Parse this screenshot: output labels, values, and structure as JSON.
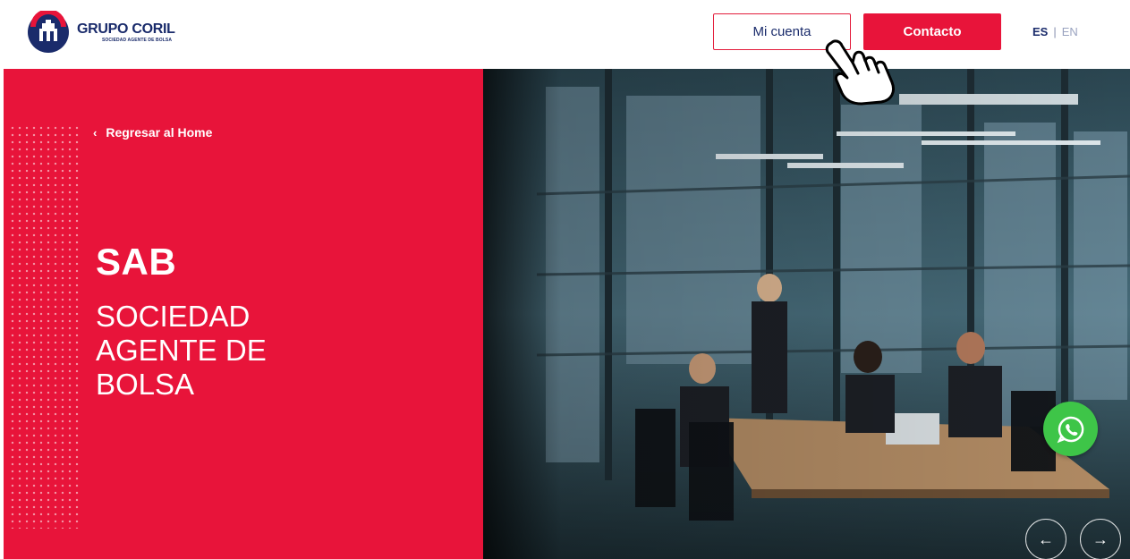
{
  "header": {
    "logo": {
      "name": "GRUPO CORIL",
      "subtitle": "SOCIEDAD AGENTE DE BOLSA"
    },
    "account_button": "Mi cuenta",
    "contact_button": "Contacto",
    "language": {
      "active": "ES",
      "separator": "|",
      "other": "EN"
    }
  },
  "hero": {
    "back_link": "Regresar al Home",
    "title": "SAB",
    "subtitle_lines": [
      "SOCIEDAD",
      "AGENTE DE",
      "BOLSA"
    ]
  },
  "colors": {
    "brand_red": "#e8143a",
    "brand_navy": "#1a2b6b",
    "whatsapp_green": "#3ec548"
  },
  "icons": {
    "back": "chevron-left-icon",
    "whatsapp": "whatsapp-icon",
    "prev": "arrow-left-icon",
    "next": "arrow-right-icon"
  }
}
